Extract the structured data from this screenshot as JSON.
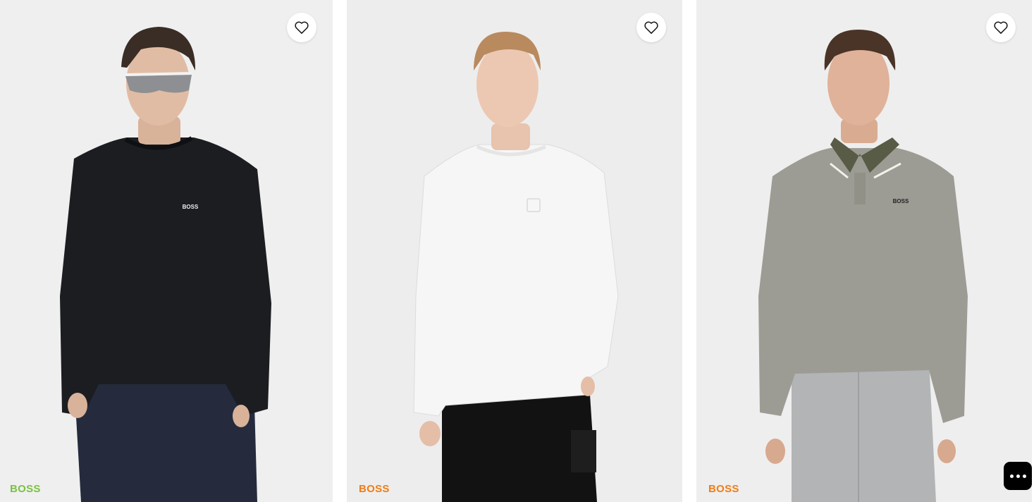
{
  "products": [
    {
      "brand": "BOSS",
      "brand_color": "#7ac143",
      "shirt_color": "#1c1d21",
      "chest_logo": "BOSS",
      "wishlist_icon": "heart-outline-icon"
    },
    {
      "brand": "BOSS",
      "brand_color": "#ef7d16",
      "shirt_color": "#f6f6f6",
      "chest_logo": "",
      "wishlist_icon": "heart-outline-icon"
    },
    {
      "brand": "BOSS",
      "brand_color": "#ef7d16",
      "shirt_color": "#9d9c94",
      "chest_logo": "BOSS",
      "wishlist_icon": "heart-outline-icon"
    }
  ],
  "chat_button": {
    "icon": "ellipsis-chat-icon"
  }
}
